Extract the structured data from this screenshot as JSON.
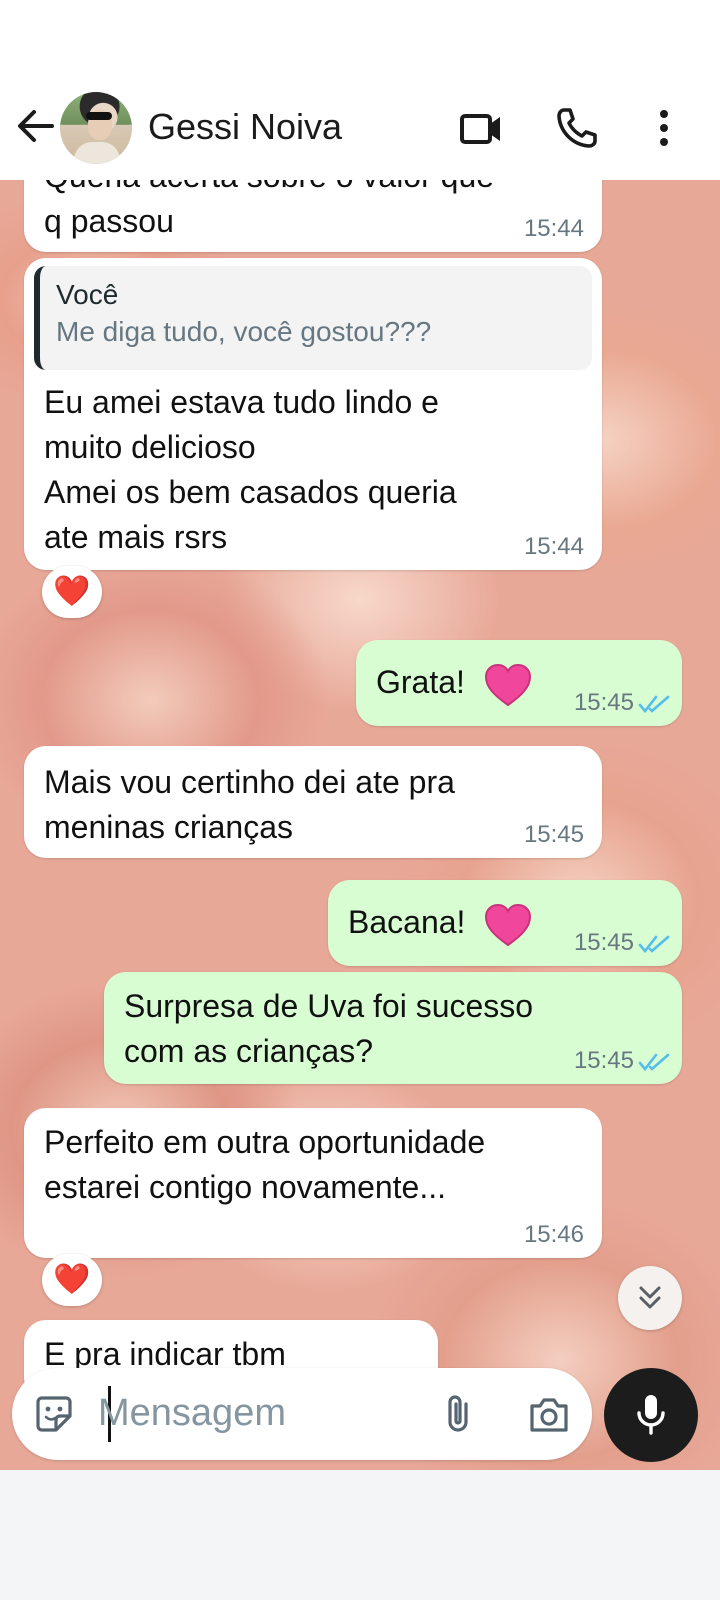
{
  "header": {
    "contact_name": "Gessi Noiva",
    "icons": [
      "back-arrow-icon",
      "video-call-icon",
      "voice-call-icon",
      "more-options-icon"
    ]
  },
  "messages": [
    {
      "id": "m1",
      "direction": "in",
      "text": "Queria acerta sobre o valor que\nq passou",
      "time": "15:44"
    },
    {
      "id": "m2",
      "direction": "in",
      "quote_author": "Você",
      "quote_text": "Me diga tudo, você gostou???",
      "text": "Eu amei estava tudo lindo e\nmuito delicioso\nAmei os bem casados queria\nate mais rsrs",
      "time": "15:44",
      "reaction": "❤️"
    },
    {
      "id": "m3",
      "direction": "out",
      "text": "Grata!",
      "time": "15:45",
      "read": true
    },
    {
      "id": "m4",
      "direction": "in",
      "text": "Mais vou certinho dei ate pra\nmeninas crianças",
      "time": "15:45"
    },
    {
      "id": "m5",
      "direction": "out",
      "text": "Bacana!",
      "time": "15:45",
      "read": true
    },
    {
      "id": "m6",
      "direction": "out",
      "text": "Surpresa de Uva foi sucesso\ncom as crianças?",
      "time": "15:45",
      "read": true
    },
    {
      "id": "m7",
      "direction": "in",
      "text": "Perfeito em outra oportunidade\nestarei contigo  novamente...",
      "time": "15:46",
      "reaction": "❤️"
    },
    {
      "id": "m8",
      "direction": "in",
      "text": "E pra indicar tbm",
      "time": ""
    }
  ],
  "composer": {
    "placeholder": "Mensagem",
    "icons": [
      "sticker-icon",
      "attach-icon",
      "camera-icon",
      "mic-icon"
    ]
  },
  "colors": {
    "incoming_bubble": "#ffffff",
    "outgoing_bubble": "#d9fdd3",
    "read_tick": "#53bdeb",
    "time_text": "#667781"
  }
}
